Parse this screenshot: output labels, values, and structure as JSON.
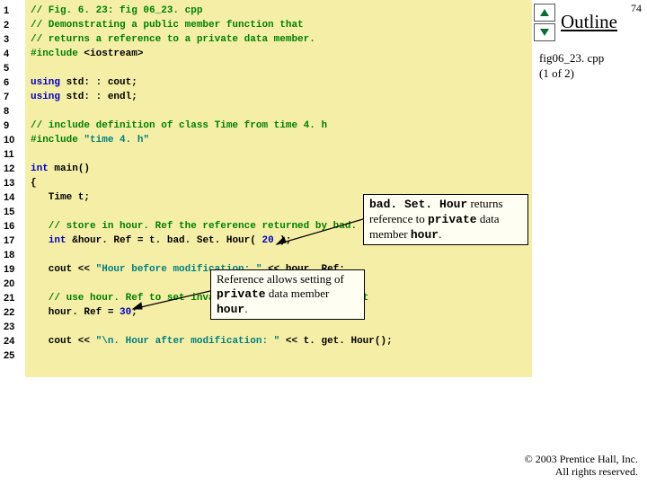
{
  "slidenum": "74",
  "outline": "Outline",
  "fig1": "fig06_23. cpp",
  "fig2": "(1 of 2)",
  "callout1_a": "bad. Set. Hour",
  "callout1_b": " returns reference to ",
  "callout1_c": "private",
  "callout1_d": " data member ",
  "callout1_e": "hour",
  "callout1_f": ".",
  "callout2_a": "Reference allows setting of ",
  "callout2_b": "private",
  "callout2_c": " data member ",
  "callout2_d": "hour",
  "callout2_e": ".",
  "copy1": "© 2003 Prentice Hall, Inc.",
  "copy2": "All rights reserved.",
  "lines": {
    "n1": "1",
    "n2": "2",
    "n3": "3",
    "n4": "4",
    "n5": "5",
    "n6": "6",
    "n7": "7",
    "n8": "8",
    "n9": "9",
    "n10": "10",
    "n11": "11",
    "n12": "12",
    "n13": "13",
    "n14": "14",
    "n15": "15",
    "n16": "16",
    "n17": "17",
    "n18": "18",
    "n19": "19",
    "n20": "20",
    "n21": "21",
    "n22": "22",
    "n23": "23",
    "n24": "24",
    "n25": "25"
  },
  "c": {
    "l1": "// Fig. 6. 23: fig 06_23. cpp",
    "l2": "// Demonstrating a public member function that",
    "l3": "// returns a reference to a private data member.",
    "l4a": "#include ",
    "l4b": "<iostream>",
    "l6a": "using ",
    "l6b": "std: : cout;",
    "l7a": "using ",
    "l7b": "std: : endl;",
    "l9": "// include definition of class Time from time 4. h",
    "l10a": "#include ",
    "l10b": "\"time 4. h\"",
    "l12a": "int",
    "l12b": " main()",
    "l13": "{",
    "l14": "   Time t;",
    "l16": "   // store in hour. Ref the reference returned by bad. Set. Hour",
    "l17a": "   ",
    "l17b": "int",
    "l17c": " &hour. Ref = t. bad. Set. Hour( ",
    "l17d": "20",
    "l17e": " );",
    "l19a": "   cout << ",
    "l19b": "\"Hour before modification: \"",
    "l19c": " << hour. Ref;",
    "l21": "   // use hour. Ref to set invalid value in Time object t",
    "l22a": "   hour. Ref = ",
    "l22b": "30",
    "l22c": ";",
    "l24a": "   cout << ",
    "l24b": "\"\\n. Hour after modification: \"",
    "l24c": " << t. get. Hour();"
  }
}
